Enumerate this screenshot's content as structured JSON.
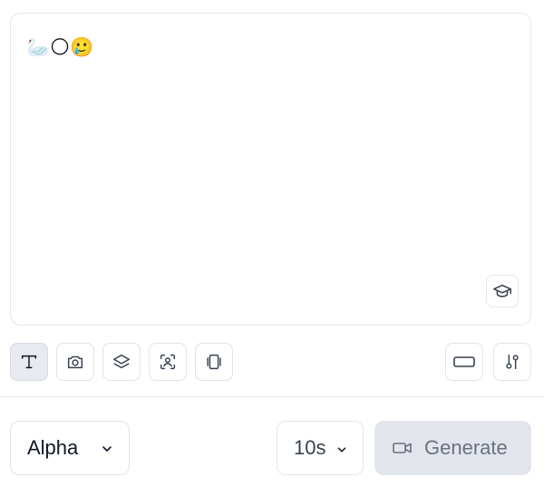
{
  "prompt": {
    "text": "🦢🌕🥲"
  },
  "prompt_actions": {
    "tutorial_icon": "graduation-cap-icon"
  },
  "toolbar": {
    "left_buttons": [
      {
        "name": "text-mode",
        "icon": "text-T-icon",
        "active": true
      },
      {
        "name": "image-mode",
        "icon": "camera-icon",
        "active": false
      },
      {
        "name": "layers-mode",
        "icon": "layers-icon",
        "active": false
      },
      {
        "name": "character-mode",
        "icon": "face-scan-icon",
        "active": false
      },
      {
        "name": "frames-mode",
        "icon": "frames-icon",
        "active": false
      }
    ],
    "right_buttons": [
      {
        "name": "aspect-ratio",
        "icon": "rectangle-icon"
      },
      {
        "name": "settings",
        "icon": "sliders-icon"
      }
    ]
  },
  "bottom_bar": {
    "model_label": "Alpha",
    "duration_label": "10s",
    "generate_label": "Generate",
    "generate_icon": "video-camera-icon"
  },
  "colors": {
    "active_button_bg": "#e7eaf0",
    "generate_bg": "#e2e6ec",
    "generate_text": "#6b7280",
    "border": "#e0e3e8"
  }
}
